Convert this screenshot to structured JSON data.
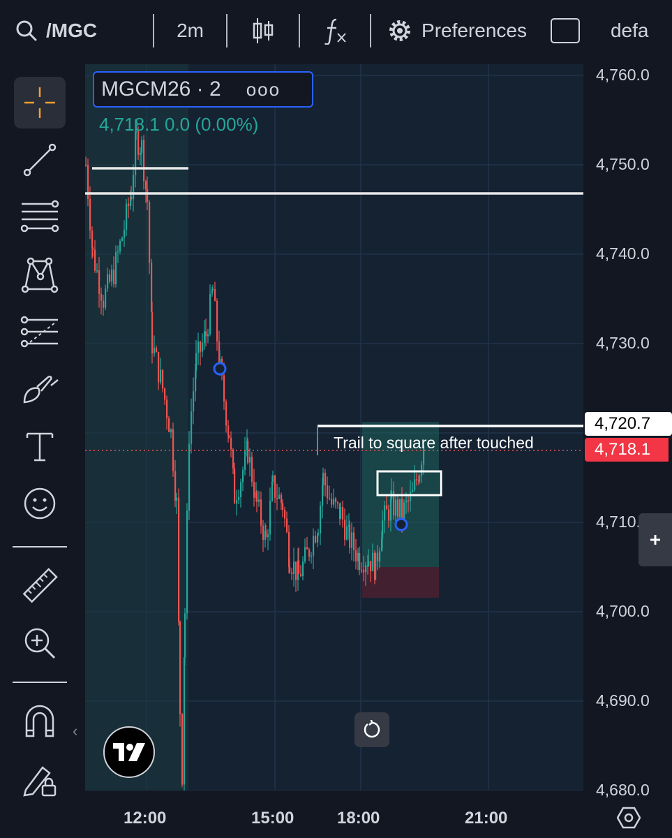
{
  "toolbar": {
    "symbol": "/MGC",
    "interval": "2m",
    "preferences": "Preferences",
    "layout": "defa"
  },
  "legend": {
    "title": "MGCM26 · 2",
    "more": "ooo",
    "quote": "4,718.1  0.0 (0.00%)"
  },
  "price_axis": {
    "labels": [
      "4,760.0",
      "4,750.0",
      "4,740.0",
      "4,730.0",
      "4,720.0",
      "4,710.0",
      "4,700.0",
      "4,690.0",
      "4,680.0"
    ],
    "line_tag": "4,720.7",
    "last_price_tag": "4,718.1"
  },
  "time_axis": {
    "labels": [
      "12:00",
      "15:00",
      "18:00",
      "21:00"
    ]
  },
  "drawings": {
    "note": "Trail to square after touched"
  },
  "colors": {
    "up": "#26a69a",
    "down": "#ef5350",
    "accent": "#2962ff",
    "background": "#131722"
  },
  "icons": [
    "search-icon",
    "candles-icon",
    "fx-icon",
    "gear-icon",
    "crosshair-icon",
    "trendline-icon",
    "fib-icon",
    "pattern-icon",
    "forecast-icon",
    "brush-icon",
    "text-icon",
    "emoji-icon",
    "ruler-icon",
    "zoom-icon",
    "magnet-icon",
    "lock-pencil-icon",
    "reset-icon",
    "settings-hex-icon",
    "plus-icon",
    "tradingview-logo"
  ]
}
